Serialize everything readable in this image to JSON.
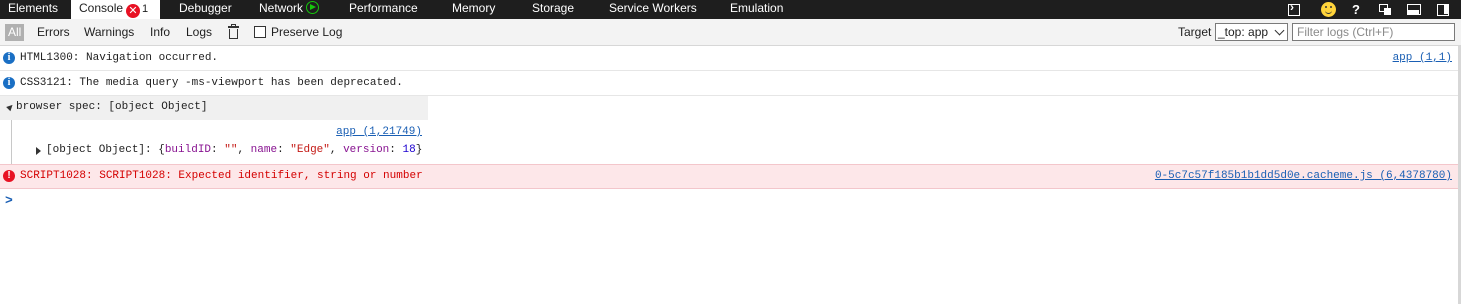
{
  "tabs": [
    {
      "label": "Elements"
    },
    {
      "label": "Console",
      "error_badge": "✕",
      "error_count": "1"
    },
    {
      "label": "Debugger"
    },
    {
      "label": "Network"
    },
    {
      "label": "Performance"
    },
    {
      "label": "Memory"
    },
    {
      "label": "Storage"
    },
    {
      "label": "Service Workers"
    },
    {
      "label": "Emulation"
    }
  ],
  "titlebar_icons": {
    "help": "?"
  },
  "toolbar": {
    "filters": [
      "All",
      "Errors",
      "Warnings",
      "Info",
      "Logs"
    ],
    "selected_filter": "All",
    "preserve_log_label": "Preserve Log",
    "preserve_log_checked": false,
    "target_label": "Target",
    "target_value": "_top: app",
    "filter_placeholder": "Filter logs (Ctrl+F)"
  },
  "messages": [
    {
      "level": "info",
      "icon": "i",
      "text": "HTML1300: Navigation occurred.",
      "source": "app (1,1)"
    },
    {
      "level": "info",
      "icon": "i",
      "text": "CSS3121: The media query -ms-viewport has been deprecated.",
      "source": ""
    },
    {
      "level": "log",
      "group_label": "browser spec: [object Object]",
      "source": "app (1,21749)",
      "object_line": {
        "prefix": "[object Object]: {",
        "k1": "buildID",
        "v1": "\"\"",
        "k2": "name",
        "v2": "\"Edge\"",
        "k3": "version",
        "v3": "18",
        "suffix": "}",
        "sep1": ": ",
        "sep2": ", ",
        "sep3": ": ",
        "sep4": ", ",
        "sep5": ": "
      }
    },
    {
      "level": "error",
      "icon": "!",
      "text": "SCRIPT1028: SCRIPT1028: Expected identifier, string or number",
      "source": "0-5c7c57f185b1b1dd5d0e.cacheme.js (6,4378780)"
    }
  ],
  "prompt": ">",
  "colors": {
    "tabbar_bg": "#1e1e1e",
    "error_bg": "#fde7e9",
    "error_text": "#d40000",
    "link": "#1a5fb4",
    "info_icon": "#1a6fc4"
  }
}
